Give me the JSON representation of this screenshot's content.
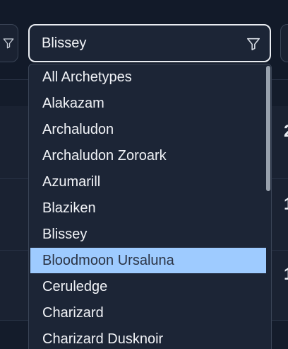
{
  "select": {
    "value": "Blissey",
    "icon": "filter-icon"
  },
  "dropdown": {
    "highlighted_index": 7,
    "options": [
      "All Archetypes",
      "Alakazam",
      "Archaludon",
      "Archaludon Zoroark",
      "Azumarill",
      "Blaziken",
      "Blissey",
      "Bloodmoon Ursaluna",
      "Ceruledge",
      "Charizard",
      "Charizard Dusknoir"
    ]
  },
  "background": {
    "row_digits": [
      "2",
      "1",
      "1"
    ]
  },
  "colors": {
    "page_bg": "#141c2b",
    "control_bg": "#1c2536",
    "highlight_bg": "#9ecbff",
    "text": "#f1f3f7",
    "border_focus": "#e9ecf1"
  }
}
